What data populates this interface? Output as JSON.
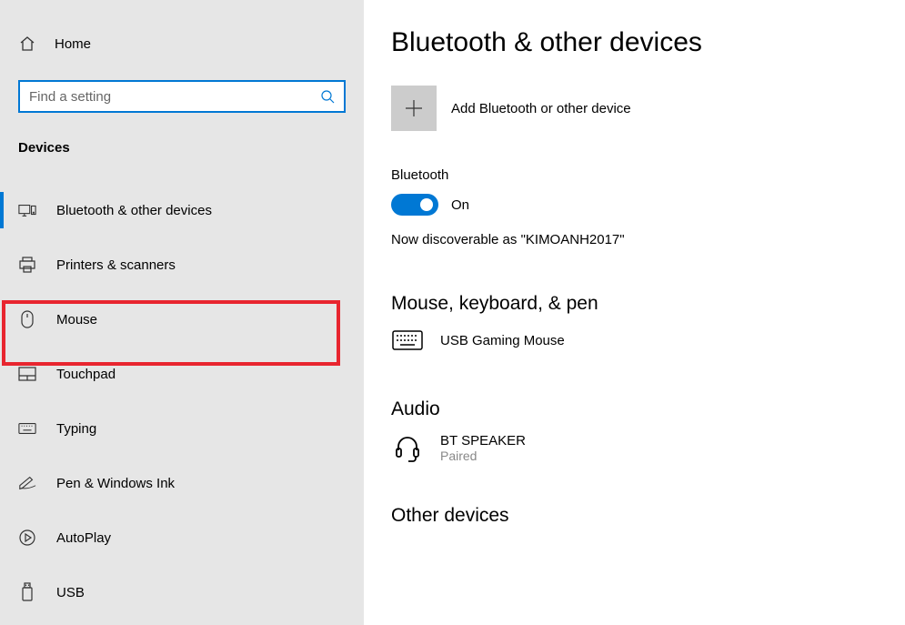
{
  "sidebar": {
    "home": "Home",
    "search_placeholder": "Find a setting",
    "section": "Devices",
    "items": [
      {
        "label": "Bluetooth & other devices"
      },
      {
        "label": "Printers & scanners"
      },
      {
        "label": "Mouse"
      },
      {
        "label": "Touchpad"
      },
      {
        "label": "Typing"
      },
      {
        "label": "Pen & Windows Ink"
      },
      {
        "label": "AutoPlay"
      },
      {
        "label": "USB"
      }
    ]
  },
  "main": {
    "title": "Bluetooth & other devices",
    "add_label": "Add Bluetooth or other device",
    "bt_label": "Bluetooth",
    "toggle_state": "On",
    "discover_text": "Now discoverable as \"KIMOANH2017\"",
    "section1": "Mouse, keyboard, & pen",
    "device1_name": "USB Gaming Mouse",
    "section2": "Audio",
    "device2_name": "BT SPEAKER",
    "device2_status": "Paired",
    "section3": "Other devices"
  }
}
